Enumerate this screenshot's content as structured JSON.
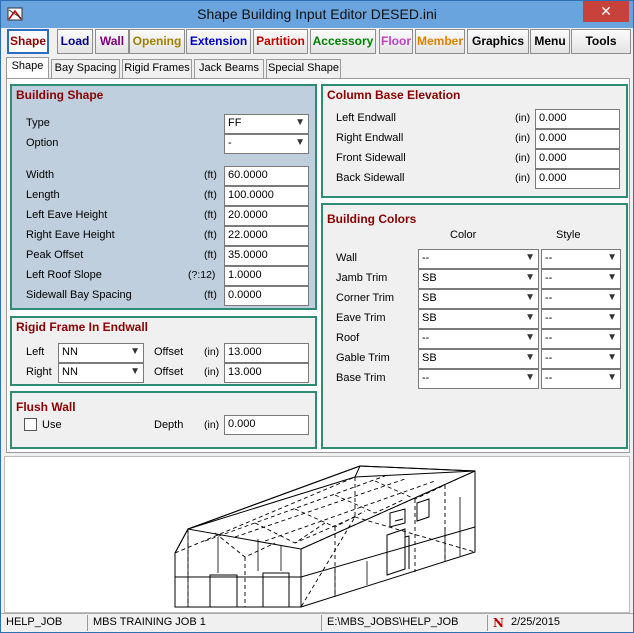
{
  "window": {
    "title": "Shape      Building Input Editor      DESED.ini",
    "close_symbol": "✕"
  },
  "toolbar": {
    "buttons": [
      {
        "label": "Shape",
        "color": "#8b0000"
      },
      {
        "label": "Load",
        "color": "#00008b"
      },
      {
        "label": "Wall",
        "color": "#800080"
      },
      {
        "label": "Opening",
        "color": "#a08000"
      },
      {
        "label": "Extension",
        "color": "#0000c0"
      },
      {
        "label": "Partition",
        "color": "#c00000"
      },
      {
        "label": "Accessory",
        "color": "#008000"
      },
      {
        "label": "Floor",
        "color": "#c040c0"
      },
      {
        "label": "Member",
        "color": "#e08000"
      },
      {
        "label": "Graphics",
        "color": "#000000"
      },
      {
        "label": "Menu",
        "color": "#000000"
      },
      {
        "label": "Tools",
        "color": "#000000"
      }
    ]
  },
  "tabs": [
    "Shape",
    "Bay Spacing",
    "Rigid Frames",
    "Jack Beams",
    "Special Shape"
  ],
  "building_shape": {
    "title": "Building Shape",
    "type_label": "Type",
    "type_value": "FF",
    "option_label": "Option",
    "option_value": "-",
    "fields": [
      {
        "label": "Width",
        "unit": "(ft)",
        "value": "60.0000"
      },
      {
        "label": "Length",
        "unit": "(ft)",
        "value": "100.0000"
      },
      {
        "label": "Left Eave Height",
        "unit": "(ft)",
        "value": "20.0000"
      },
      {
        "label": "Right Eave Height",
        "unit": "(ft)",
        "value": "22.0000"
      },
      {
        "label": "Peak Offset",
        "unit": "(ft)",
        "value": "35.0000"
      },
      {
        "label": "Left Roof Slope",
        "unit": "(?:12)",
        "value": "1.0000"
      },
      {
        "label": "Sidewall Bay Spacing",
        "unit": "(ft)",
        "value": "0.0000"
      }
    ]
  },
  "rigid_frame": {
    "title": "Rigid Frame In Endwall",
    "rows": [
      {
        "label": "Left",
        "select": "NN",
        "offset_label": "Offset",
        "unit": "(in)",
        "value": "13.000"
      },
      {
        "label": "Right",
        "select": "NN",
        "offset_label": "Offset",
        "unit": "(in)",
        "value": "13.000"
      }
    ]
  },
  "flush_wall": {
    "title": "Flush Wall",
    "use_label": "Use",
    "depth_label": "Depth",
    "unit": "(in)",
    "value": "0.000"
  },
  "column_base": {
    "title": "Column Base Elevation",
    "fields": [
      {
        "label": "Left Endwall",
        "unit": "(in)",
        "value": "0.000"
      },
      {
        "label": "Right Endwall",
        "unit": "(in)",
        "value": "0.000"
      },
      {
        "label": "Front Sidewall",
        "unit": "(in)",
        "value": "0.000"
      },
      {
        "label": "Back Sidewall",
        "unit": "(in)",
        "value": "0.000"
      }
    ]
  },
  "building_colors": {
    "title": "Building Colors",
    "color_header": "Color",
    "style_header": "Style",
    "rows": [
      {
        "label": "Wall",
        "color": "--",
        "style": "--"
      },
      {
        "label": "Jamb Trim",
        "color": "SB",
        "style": "--"
      },
      {
        "label": "Corner Trim",
        "color": "SB",
        "style": "--"
      },
      {
        "label": "Eave Trim",
        "color": "SB",
        "style": "--"
      },
      {
        "label": "Roof",
        "color": "--",
        "style": "--"
      },
      {
        "label": "Gable Trim",
        "color": "SB",
        "style": "--"
      },
      {
        "label": "Base Trim",
        "color": "--",
        "style": "--"
      }
    ]
  },
  "statusbar": {
    "job": "HELP_JOB",
    "job_name": "MBS TRAINING JOB 1",
    "path": "E:\\MBS_JOBS\\HELP_JOB",
    "date": "2/25/2015"
  }
}
